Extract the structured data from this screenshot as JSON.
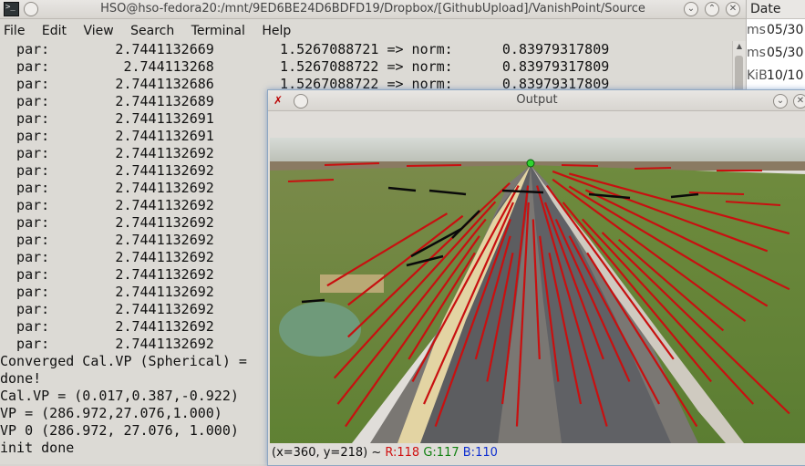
{
  "terminal": {
    "title": "HSO@hso-fedora20:/mnt/9ED6BE24D6BDFD19/Dropbox/[GithubUpload]/VanishPoint/Source",
    "menu": [
      "File",
      "Edit",
      "View",
      "Search",
      "Terminal",
      "Help"
    ],
    "lines": [
      "  par:        2.7441132669        1.5267088721 => norm:      0.83979317809",
      "  par:         2.744113268        1.5267088722 => norm:      0.83979317809",
      "  par:        2.7441132686        1.5267088722 => norm:      0.83979317809",
      "  par:        2.7441132689",
      "  par:        2.7441132691",
      "  par:        2.7441132691",
      "  par:        2.7441132692",
      "  par:        2.7441132692",
      "  par:        2.7441132692",
      "  par:        2.7441132692",
      "  par:        2.7441132692",
      "  par:        2.7441132692",
      "  par:        2.7441132692",
      "  par:        2.7441132692",
      "  par:        2.7441132692",
      "  par:        2.7441132692",
      "  par:        2.7441132692",
      "  par:        2.7441132692",
      "Converged Cal.VP (Spherical) =",
      "done!",
      "Cal.VP = (0.017,0.387,-0.922)",
      "VP = (286.972,27.076,1.000)",
      "VP 0 (286.972, 27.076, 1.000)",
      "init done"
    ]
  },
  "file_manager": {
    "header": "Date",
    "rows": [
      {
        "left": "ms",
        "right": "05/30"
      },
      {
        "left": "ms",
        "right": "05/30"
      },
      {
        "left": "KiB",
        "right": "10/10"
      }
    ]
  },
  "output": {
    "title": "Output",
    "status_prefix": "(x=360, y=218) ~ ",
    "status_r": "R:118",
    "status_g": "G:117",
    "status_b": "B:110"
  },
  "colors": {
    "detected_line": "#c81010",
    "vanishing_point": "#2fd52f",
    "sky": "#c9cfc9",
    "field": "#708a3c",
    "road": "#5d5e61"
  }
}
